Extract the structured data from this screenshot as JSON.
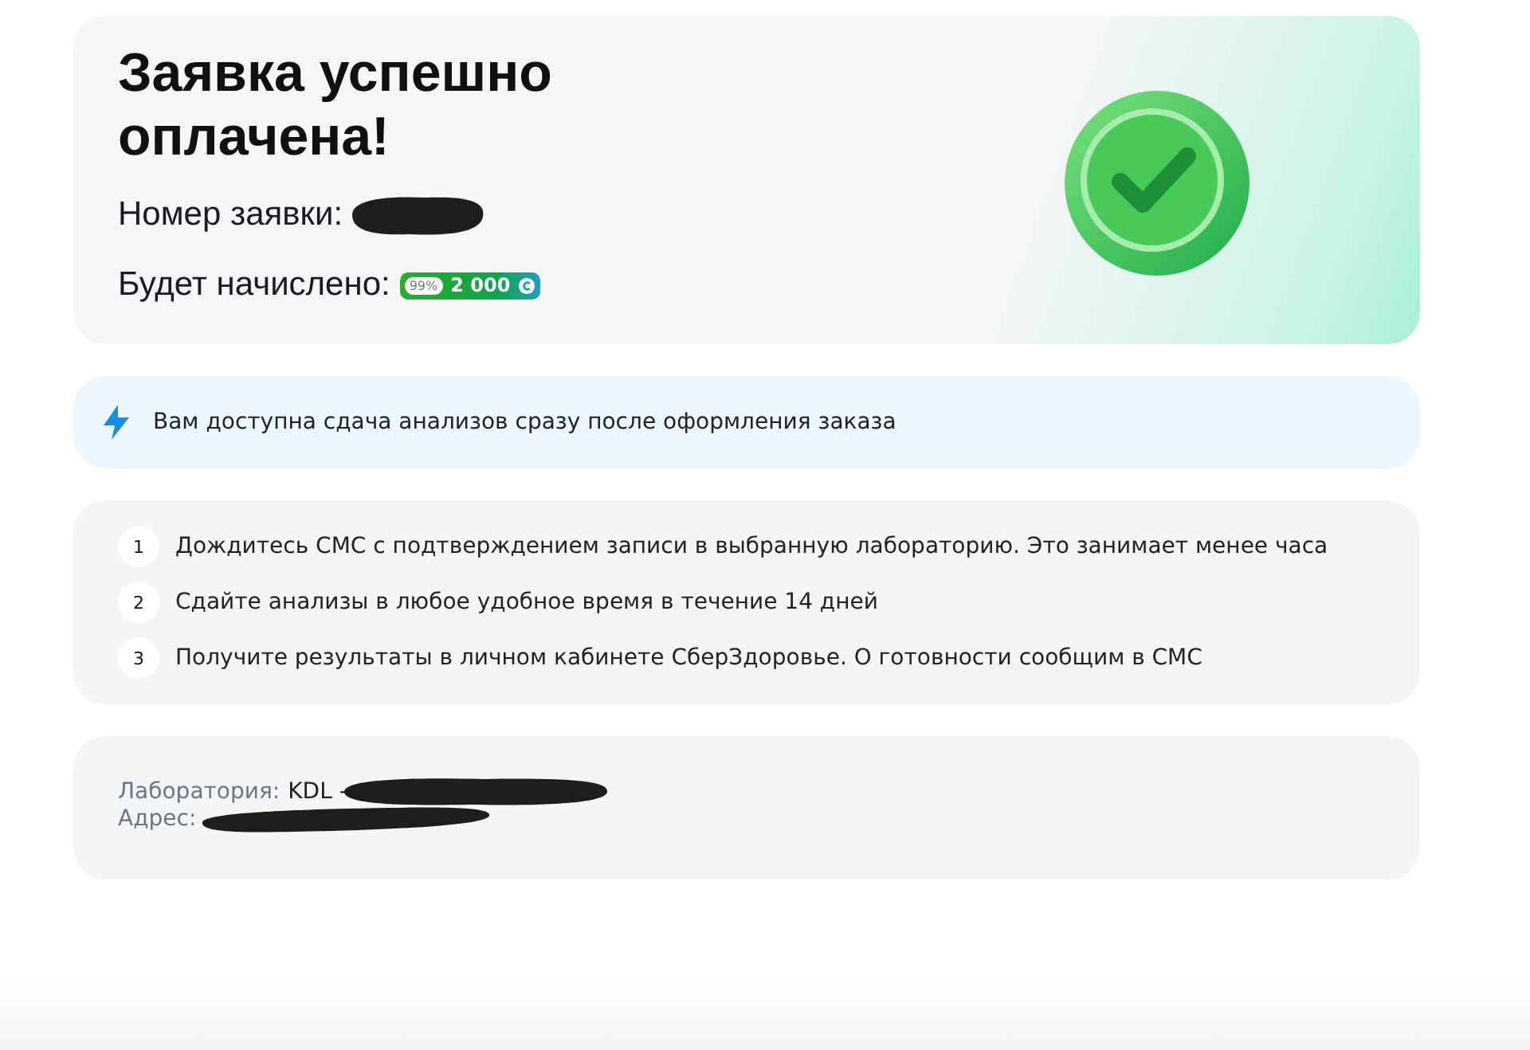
{
  "order": {
    "title": "Заявка успешно оплачена!",
    "number_label": "Номер заявки:",
    "bonus_label": "Будет начислено:",
    "bonus_percent": "99%",
    "bonus_amount": "2 000"
  },
  "notice": {
    "text": "Вам доступна сдача анализов сразу после оформления заказа"
  },
  "steps": [
    {
      "number": "1",
      "text": "Дождитесь СМС с подтверждением записи в выбранную лабораторию. Это занимает менее часа"
    },
    {
      "number": "2",
      "text": "Сдайте анализы в любое удобное время в течение 14 дней"
    },
    {
      "number": "3",
      "text": "Получите результаты в личном кабинете СберЗдоровье. О готовности сообщим в СМС"
    }
  ],
  "lab": {
    "lab_label": "Лаборатория:",
    "lab_value": "KDL -",
    "address_label": "Адрес:"
  }
}
